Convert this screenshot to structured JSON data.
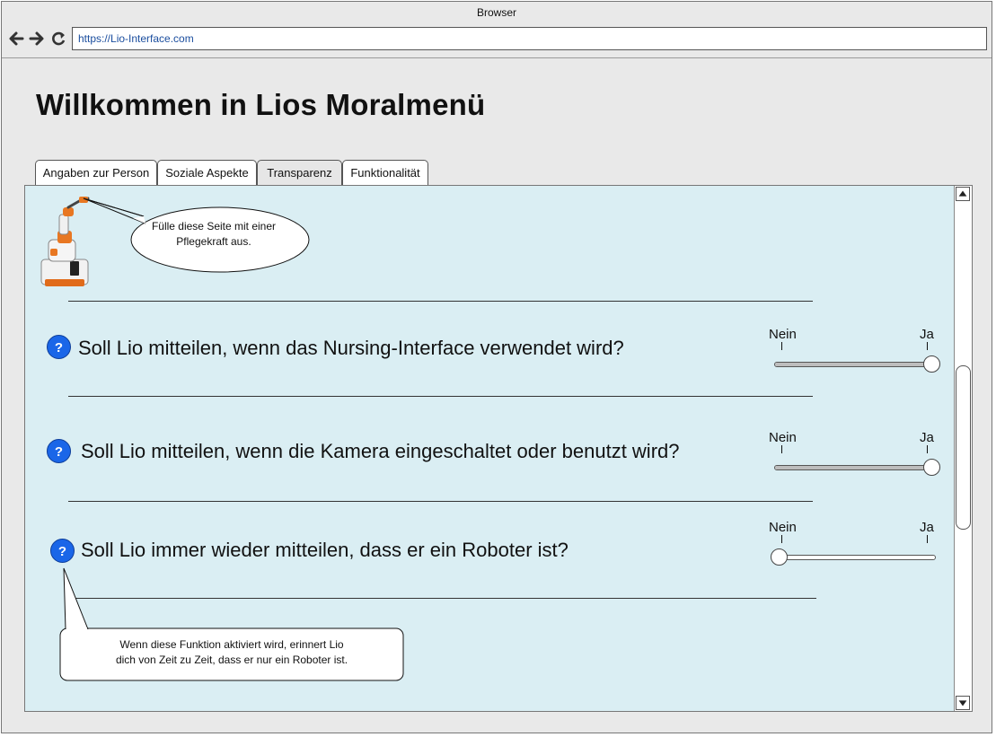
{
  "browser": {
    "title": "Browser",
    "url": "https://Lio-Interface.com"
  },
  "page": {
    "title": "Willkommen in Lios Moralmenü"
  },
  "tabs": [
    {
      "label": "Angaben zur Person",
      "active": false
    },
    {
      "label": "Soziale Aspekte",
      "active": false
    },
    {
      "label": "Transparenz",
      "active": true
    },
    {
      "label": "Funktionalität",
      "active": false
    }
  ],
  "robot_hint": {
    "line1": "Fülle diese Seite mit einer",
    "line2": "Pflegekraft aus."
  },
  "questions": [
    {
      "icon_text": "?",
      "text": "Soll Lio mitteilen, wenn das Nursing-Interface verwendet wird?",
      "min_label": "Nein",
      "max_label": "Ja",
      "value": 1
    },
    {
      "icon_text": "?",
      "text": "Soll Lio mitteilen, wenn die Kamera eingeschaltet oder benutzt wird?",
      "min_label": "Nein",
      "max_label": "Ja",
      "value": 1
    },
    {
      "icon_text": "?",
      "text": "Soll Lio immer wieder mitteilen, dass er ein Roboter ist?",
      "min_label": "Nein",
      "max_label": "Ja",
      "value": 0
    }
  ],
  "tooltip": {
    "line1": "Wenn diese Funktion aktiviert wird, erinnert Lio",
    "line2": "dich von Zeit zu Zeit, dass er nur ein Roboter ist."
  },
  "colors": {
    "content_bg": "#daeef3",
    "help_icon": "#1a66e8"
  },
  "icons": [
    "back-arrow-icon",
    "forward-arrow-icon",
    "reload-icon",
    "question-mark-icon",
    "robot-image"
  ]
}
